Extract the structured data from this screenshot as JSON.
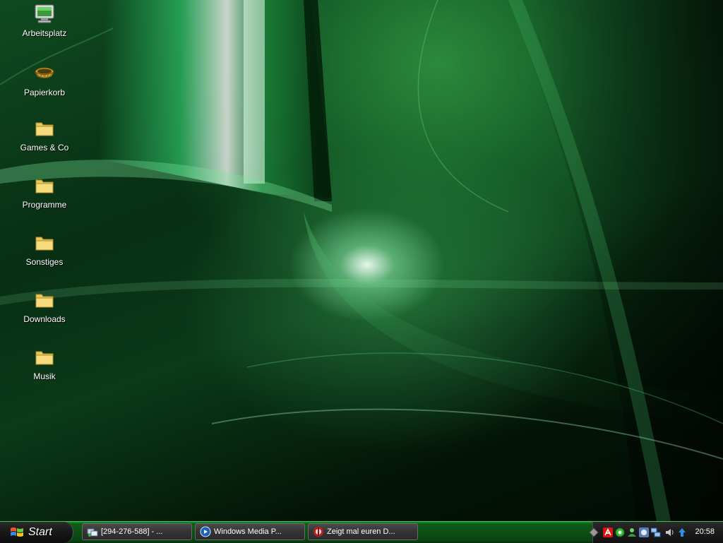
{
  "desktop": {
    "icons": [
      {
        "label": "Arbeitsplatz",
        "icon": "my-computer-icon"
      },
      {
        "label": "Papierkorb",
        "icon": "recycle-bin-icon"
      },
      {
        "label": "Games & Co",
        "icon": "folder-icon"
      },
      {
        "label": "Programme",
        "icon": "folder-icon"
      },
      {
        "label": "Sonstiges",
        "icon": "folder-icon"
      },
      {
        "label": "Downloads",
        "icon": "folder-icon"
      },
      {
        "label": "Musik",
        "icon": "folder-icon"
      }
    ]
  },
  "taskbar": {
    "start_label": "Start",
    "tasks": [
      {
        "label": "[294-276-588] - ...",
        "icon": "network-app-icon"
      },
      {
        "label": "Windows Media P...",
        "icon": "media-player-icon"
      },
      {
        "label": "Zeigt mal euren D...",
        "icon": "browser-icon"
      }
    ],
    "tray": {
      "icons": [
        "show-hidden-icon",
        "antivirus-icon",
        "green-gear-icon",
        "user-icon",
        "shield-icon",
        "network-icon",
        "speaker-icon",
        "update-arrow-icon"
      ],
      "clock": "20:58"
    }
  },
  "colors": {
    "wallpaper_accent": "#2b8a3c",
    "taskbar": "#0b4f14",
    "start_button": "#1a1a1a"
  }
}
